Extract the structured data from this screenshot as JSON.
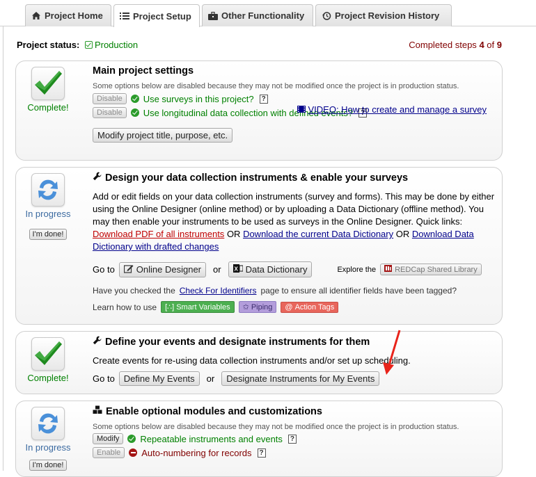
{
  "tabs": [
    {
      "label": "Project Home",
      "icon": "home-icon"
    },
    {
      "label": "Project Setup",
      "icon": "list-icon",
      "active": true
    },
    {
      "label": "Other Functionality",
      "icon": "briefcase-icon"
    },
    {
      "label": "Project Revision History",
      "icon": "history-icon"
    }
  ],
  "status": {
    "label": "Project status:",
    "value": "Production"
  },
  "steps": {
    "prefix": "Completed steps",
    "done": "4",
    "of": "of",
    "total": "9"
  },
  "card1": {
    "state": "Complete!",
    "title": "Main project settings",
    "note": "Some options below are disabled because they may not be modified once the project is in production status.",
    "disable1": "Disable",
    "option1": "Use surveys in this project?",
    "disable2": "Disable",
    "option2": "Use longitudinal data collection with defined events?",
    "video": "VIDEO: How to create and manage a survey",
    "modify": "Modify project title, purpose, etc."
  },
  "card2": {
    "state": "In progress",
    "done_btn": "I'm done!",
    "title": "Design your data collection instruments & enable your surveys",
    "para1": "Add or edit fields on your data collection instruments (survey and forms). This may be done by either using the Online Designer (online method) or by uploading a Data Dictionary (offline method). You may then enable your instruments to be used as surveys in the Online Designer. Quick links:",
    "link_pdf": "Download PDF of all instruments",
    "or1": "OR",
    "link_dd": "Download the current Data Dictionary",
    "or2": "OR",
    "link_drafted": "Download Data Dictionary with drafted changes",
    "goto": "Go to",
    "online_designer": "Online Designer",
    "or3": "or",
    "data_dictionary": "Data Dictionary",
    "explore": "Explore the",
    "shared_library": "REDCap Shared Library",
    "identifiers_pre": "Have you checked the",
    "identifiers_link": "Check For Identifiers",
    "identifiers_post": "page to ensure all identifier fields have been tagged?",
    "learn": "Learn how to use",
    "smart_vars": "Smart Variables",
    "piping": "Piping",
    "action_tags": "Action Tags"
  },
  "card3": {
    "state": "Complete!",
    "title": "Define your events and designate instruments for them",
    "para": "Create events for re-using data collection instruments and/or set up scheduling.",
    "goto": "Go to",
    "define_events": "Define My Events",
    "or": "or",
    "designate": "Designate Instruments for My Events"
  },
  "card4": {
    "state": "In progress",
    "done_btn": "I'm done!",
    "title": "Enable optional modules and customizations",
    "note": "Some options below are disabled because they may not be modified once the project is in production status.",
    "modify": "Modify",
    "option1": "Repeatable instruments and events",
    "enable": "Enable",
    "option2": "Auto-numbering for records"
  },
  "colors": {
    "green": "#008000",
    "darkred": "#800000",
    "link": "#00008b",
    "arrow": "#e8231a"
  }
}
